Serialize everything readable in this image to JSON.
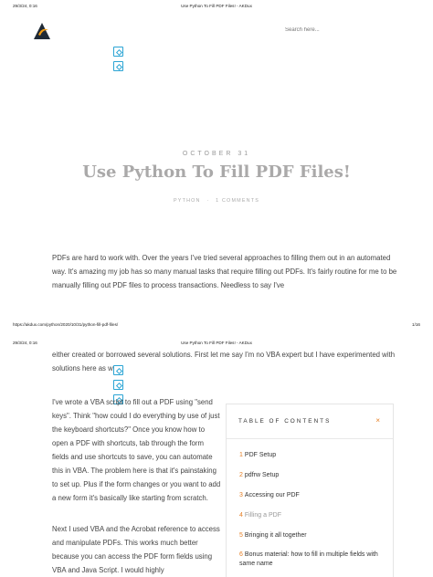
{
  "print": {
    "date": "29/3/24, 0:16",
    "page_title": "Use Python To Fill PDF Files! - AKDux",
    "url": "https://akdux.com/python/2020/10/31/python-fill-pdf-files/",
    "page_number": "1/16"
  },
  "header": {
    "search_placeholder": "Search here..."
  },
  "post": {
    "date": "OCTOBER 31",
    "title": "Use Python To Fill PDF Files!",
    "category": "PYTHON",
    "comments": "1 COMMENTS",
    "paragraphs": [
      "PDFs are hard to work with. Over the years I've tried several approaches to filling them out in an automated way. It's amazing my job has so many manual tasks that require filling out PDFs. It's fairly routine for me to be manually filling out PDF files to process transactions. Needless to say I've",
      "either created or borrowed several solutions. First let me say I'm no VBA expert but I have experimented with solutions here as well.",
      "I've wrote a VBA script to fill out a PDF using \"send keys\". Think \"how could I do everything by use of just the keyboard shortcuts?\" Once you know how to open a PDF with shortcuts, tab through the form fields and use shortcuts to save, you can automate this in VBA. The problem here is that it's painstaking to set up. Plus if the form changes or you want to add a new form it's basically like starting from scratch.",
      "Next I used VBA and the Acrobat reference to access and manipulate PDFs. This works much better because you can access the PDF form fields using VBA and Java Script. I would highly"
    ]
  },
  "toc": {
    "heading": "TABLE OF CONTENTS",
    "close": "×",
    "items": [
      {
        "num": "1",
        "label": "PDF Setup"
      },
      {
        "num": "2",
        "label": "pdfrw Setup"
      },
      {
        "num": "3",
        "label": "Accessing our PDF"
      },
      {
        "num": "4",
        "label": "Filling a PDF"
      },
      {
        "num": "5",
        "label": "Bringing it all together"
      },
      {
        "num": "6",
        "label": "Bonus material: how to fill in multiple fields with same name"
      }
    ]
  },
  "colors": {
    "accent": "#e67e22",
    "share": "#2aa4d4",
    "title": "#aaa9a9"
  }
}
